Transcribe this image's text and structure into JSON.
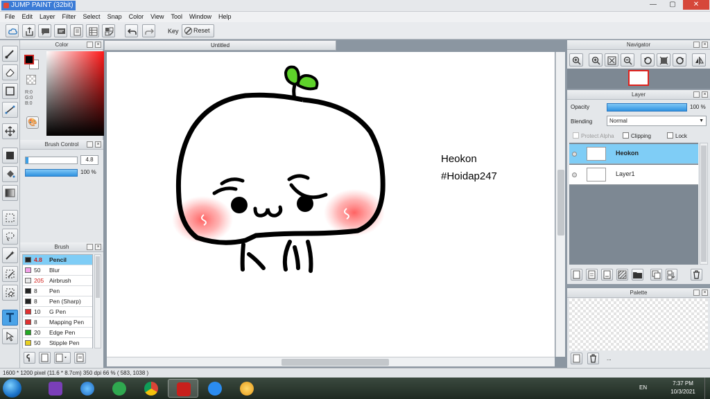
{
  "window": {
    "title": "JUMP PAINT (32bit)",
    "minimize": "—",
    "maximize": "▢",
    "close": "✕"
  },
  "menu": [
    "File",
    "Edit",
    "Layer",
    "Filter",
    "Select",
    "Snap",
    "Color",
    "View",
    "Tool",
    "Window",
    "Help"
  ],
  "toolbar": {
    "key_label": "Key",
    "reset_label": "Reset"
  },
  "color_panel": {
    "title": "Color",
    "rgb": [
      "R:0",
      "G:0",
      "B:0"
    ],
    "fg_color": "#000000",
    "bg_color": "#ffffff"
  },
  "brush_control": {
    "title": "Brush Control",
    "size": "4.8",
    "opacity": "100 %"
  },
  "brush_panel": {
    "title": "Brush",
    "items": [
      {
        "size": "4.8",
        "name": "Pencil",
        "color": "#222222",
        "size_color": "#d0201c"
      },
      {
        "size": "50",
        "name": "Blur",
        "color": "#f3a0e8",
        "size_color": "#222222"
      },
      {
        "size": "205",
        "name": "Airbrush",
        "color": "#e8e8e8",
        "size_color": "#d0201c"
      },
      {
        "size": "8",
        "name": "Pen",
        "color": "#222222",
        "size_color": "#222222"
      },
      {
        "size": "8",
        "name": "Pen (Sharp)",
        "color": "#222222",
        "size_color": "#222222"
      },
      {
        "size": "10",
        "name": "G Pen",
        "color": "#e03030",
        "size_color": "#222222"
      },
      {
        "size": "8",
        "name": "Mapping Pen",
        "color": "#e03030",
        "size_color": "#222222"
      },
      {
        "size": "20",
        "name": "Edge Pen",
        "color": "#22aa22",
        "size_color": "#222222"
      },
      {
        "size": "50",
        "name": "Stipple Pen",
        "color": "#e8d020",
        "size_color": "#222222"
      }
    ]
  },
  "document": {
    "tab_title": "Untitled",
    "text_line_1": "Heokon",
    "text_line_2": "#Hoidap247"
  },
  "navigator": {
    "title": "Navigator"
  },
  "layer_panel": {
    "title": "Layer",
    "opacity_label": "Opacity",
    "opacity_value": "100 %",
    "blending_label": "Blending",
    "blending_value": "Normal",
    "protect_alpha": "Protect Alpha",
    "clipping": "Clipping",
    "lock": "Lock",
    "layers": [
      {
        "name": "Heokon",
        "selected": true
      },
      {
        "name": "Layer1",
        "selected": false
      }
    ]
  },
  "palette_panel": {
    "title": "Palette",
    "ellipsis": "..."
  },
  "status": {
    "text": "1600 * 1200 pixel   (11.6 * 8.7cm)   350 dpi   66 %   ( 583, 1038 )"
  },
  "taskbar": {
    "language": "EN",
    "time": "7:37 PM",
    "date": "10/3/2021"
  }
}
